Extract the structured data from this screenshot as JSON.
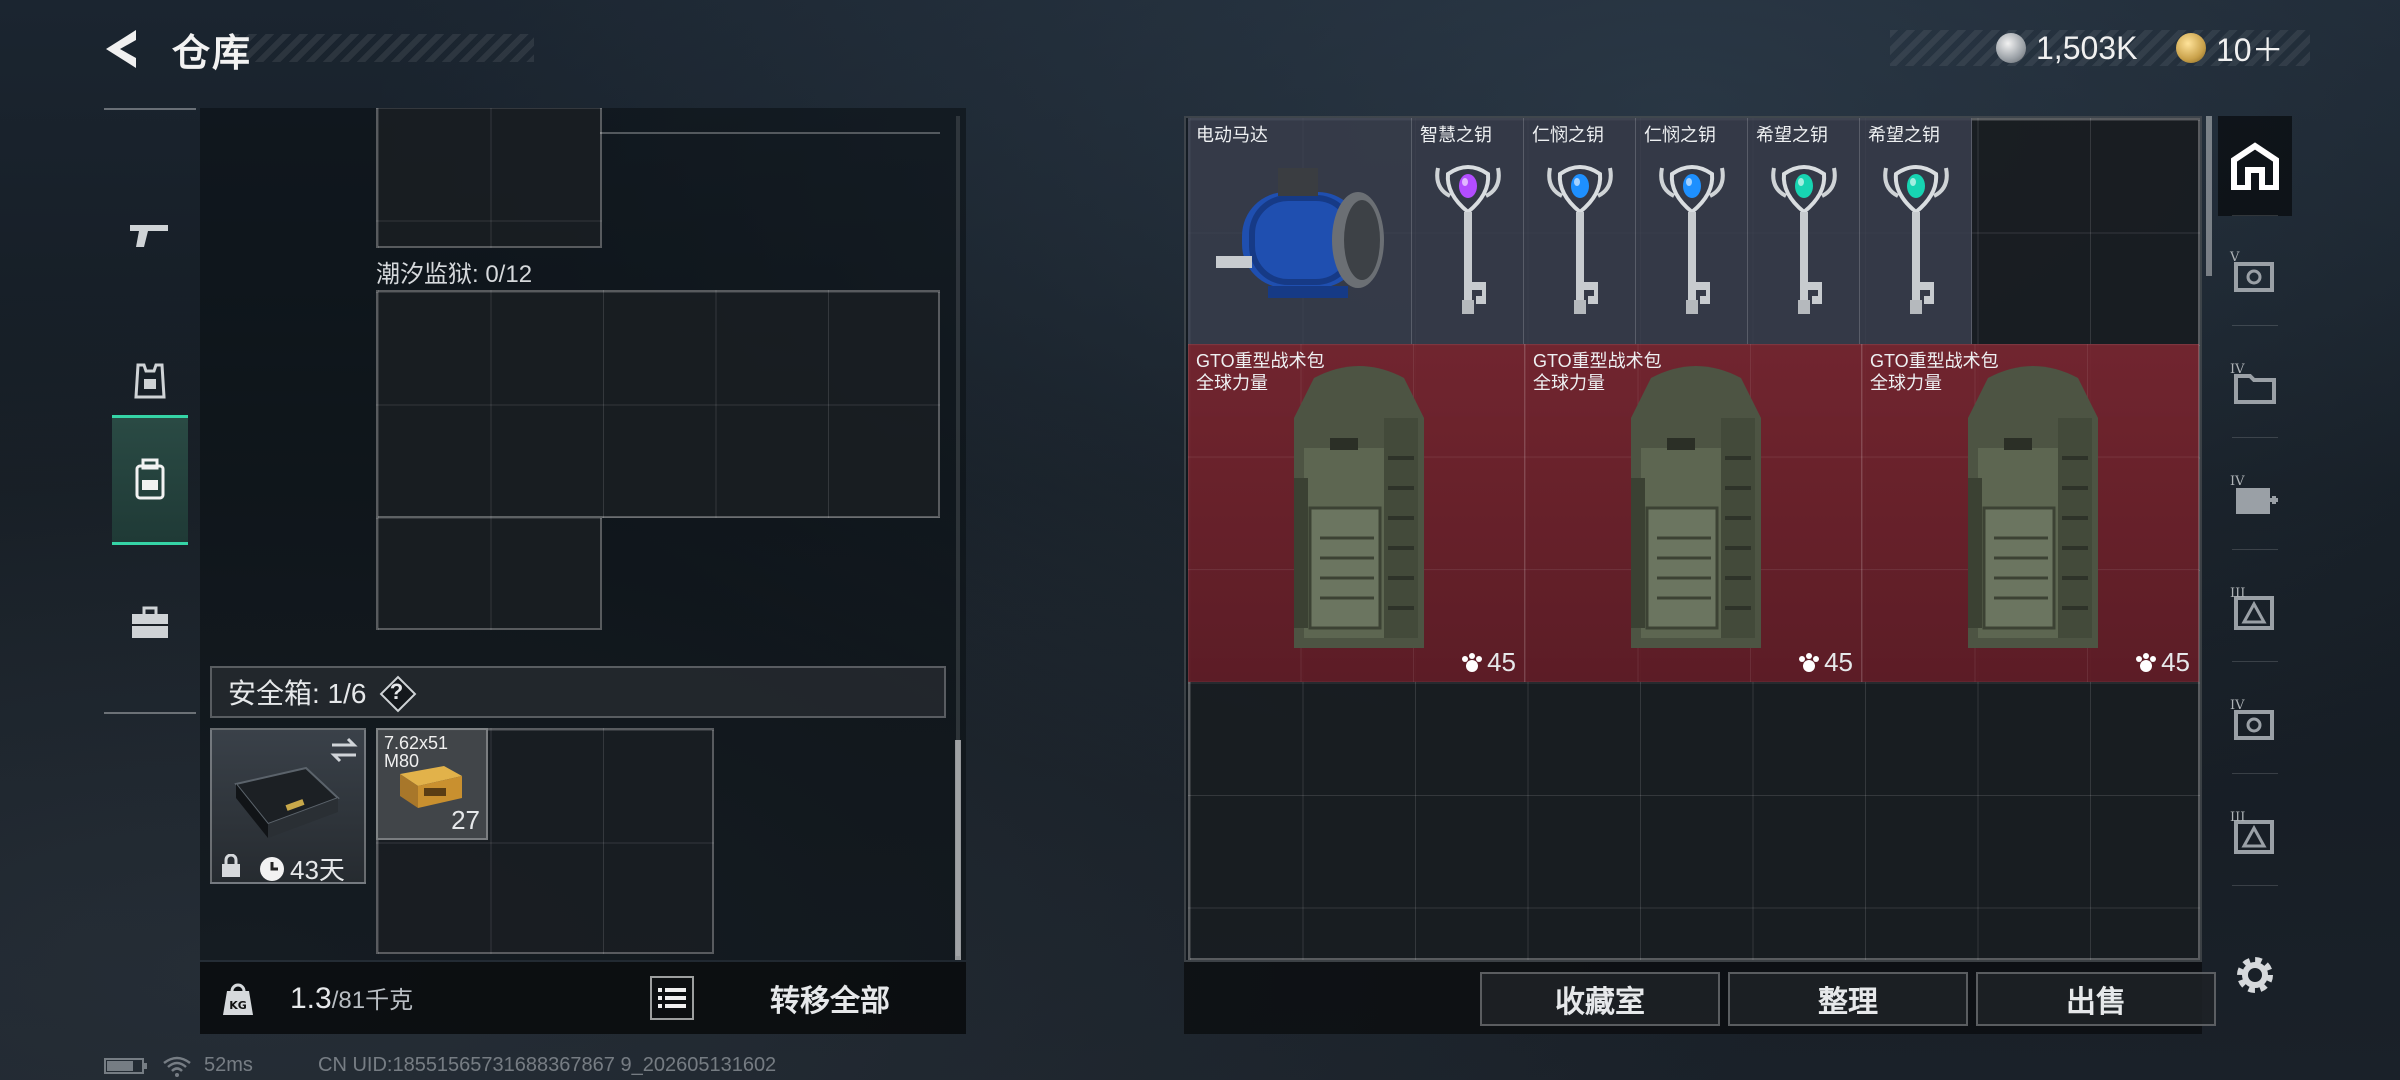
{
  "header": {
    "title": "仓库",
    "currencies": [
      {
        "icon": "silver-coin-icon",
        "value": "1,503K"
      },
      {
        "icon": "gold-coin-icon",
        "value": "10＋"
      }
    ]
  },
  "nav": {
    "items": [
      {
        "name": "weapons",
        "icon": "gun-icon"
      },
      {
        "name": "armor",
        "icon": "armor-icon"
      },
      {
        "name": "backpack",
        "icon": "backpack-icon",
        "active": true
      },
      {
        "name": "cases",
        "icon": "briefcase-icon"
      }
    ]
  },
  "storage": {
    "section_label": "潮汐监狱: 0/12",
    "safebox_label": "安全箱: 1/6",
    "help_label": "?",
    "safe_case": {
      "days": "43天"
    },
    "ammo": {
      "name": "7.62x51\nM80",
      "count": "27"
    },
    "weight_current": "1.3",
    "weight_max": "/81千克",
    "transfer_all_label": "转移全部"
  },
  "container": {
    "items": [
      {
        "name": "电动马达",
        "icon": "electric-motor-icon"
      },
      {
        "name": "智慧之钥",
        "icon": "key-icon",
        "gem_color": "#b34dff"
      },
      {
        "name": "仁悯之钥",
        "icon": "key-icon",
        "gem_color": "#1e90ff"
      },
      {
        "name": "仁悯之钥",
        "icon": "key-icon",
        "gem_color": "#1e90ff"
      },
      {
        "name": "希望之钥",
        "icon": "key-icon",
        "gem_color": "#17d4b2"
      },
      {
        "name": "希望之钥",
        "icon": "key-icon",
        "gem_color": "#17d4b2"
      }
    ],
    "packs": [
      {
        "name": "GTO重型战术包",
        "sub": "全球力量",
        "count": "45"
      },
      {
        "name": "GTO重型战术包",
        "sub": "全球力量",
        "count": "45"
      },
      {
        "name": "GTO重型战术包",
        "sub": "全球力量",
        "count": "45"
      }
    ],
    "buttons": {
      "collection": "收藏室",
      "arrange": "整理",
      "sell": "出售"
    }
  },
  "side_tabs": [
    {
      "icon": "home-icon",
      "tier": "",
      "active": true
    },
    {
      "icon": "safe-icon",
      "tier": "V"
    },
    {
      "icon": "folder-icon",
      "tier": "IV"
    },
    {
      "icon": "medkit-icon",
      "tier": "IV"
    },
    {
      "icon": "tool-icon",
      "tier": "III"
    },
    {
      "icon": "safe-icon",
      "tier": "IV"
    },
    {
      "icon": "tool-icon",
      "tier": "III"
    }
  ],
  "status": {
    "ping": "52ms",
    "uid": "CN UID:18551565731688367867 9_202605131602"
  },
  "colors": {
    "accent": "#35d4a6",
    "pack_bg": "#7a2630"
  }
}
